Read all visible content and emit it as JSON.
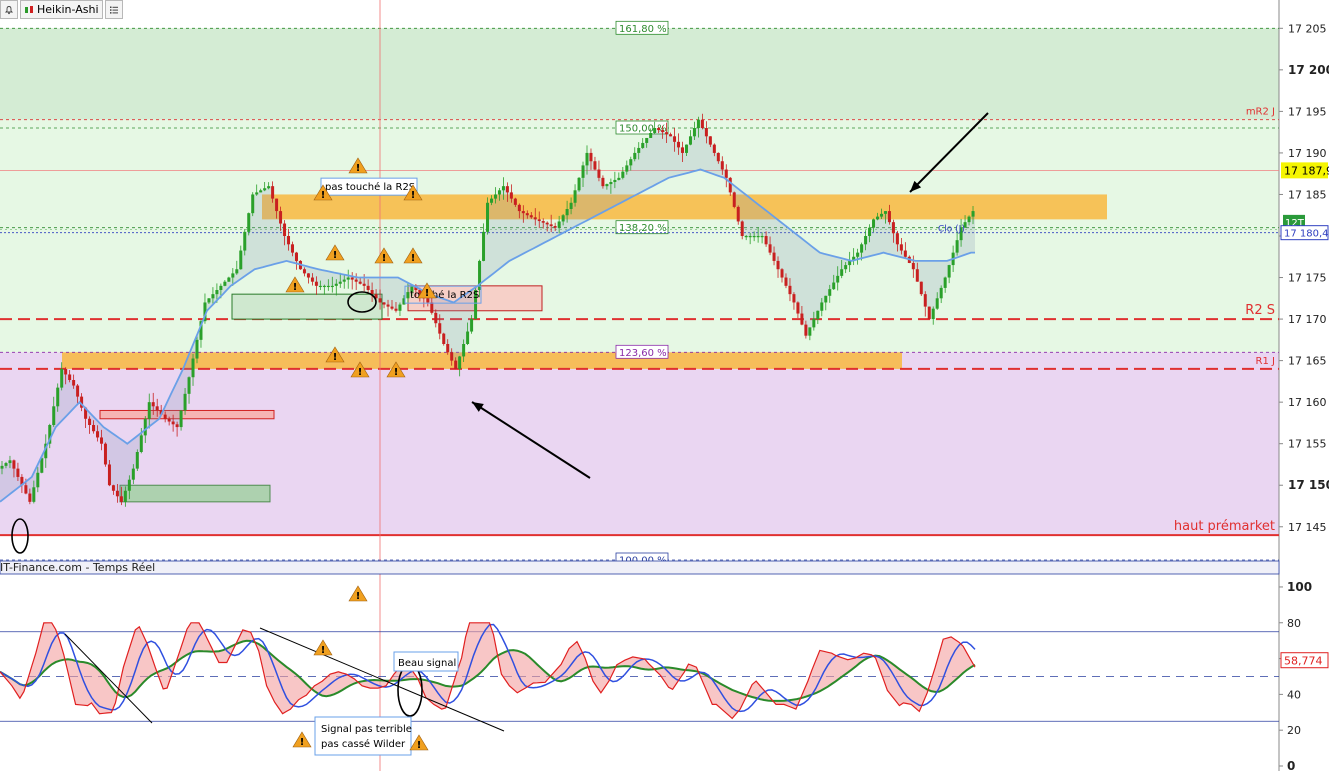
{
  "toolbar": {
    "bell_icon": "bell-icon",
    "chart_type_label": "Heikin-Ashi",
    "chart_type_icon": "candle-icon",
    "list_icon": "list-icon"
  },
  "source_label": "IT-Finance.com - Temps Réel",
  "chart_data": [
    {
      "type": "candlestick",
      "series": [
        {
          "name": "Heikin-Ashi"
        },
        {
          "name": "Clo (J)"
        }
      ],
      "ylim": [
        17141,
        17206
      ],
      "y_ticks": [
        17205,
        17200,
        17195,
        17190,
        17185,
        17180,
        17175,
        17170,
        17165,
        17160,
        17155,
        17150,
        17145
      ],
      "y_tick_labels": [
        "17 205",
        "17 200",
        "17 195",
        "17 190",
        "17 185",
        "17 180",
        "17 175",
        "17 170",
        "17 165",
        "17 160",
        "17 155",
        "17 150",
        "17 145"
      ],
      "bold_ticks": [
        "17 200",
        "17 150"
      ],
      "x_index_range": [
        0,
        245
      ],
      "price_path": [
        [
          0,
          17152
        ],
        [
          3,
          17153
        ],
        [
          8,
          17148
        ],
        [
          12,
          17155
        ],
        [
          16,
          17164
        ],
        [
          19,
          17162
        ],
        [
          22,
          17158
        ],
        [
          26,
          17155
        ],
        [
          28,
          17150
        ],
        [
          31,
          17148
        ],
        [
          34,
          17152
        ],
        [
          38,
          17160
        ],
        [
          42,
          17158
        ],
        [
          45,
          17157
        ],
        [
          48,
          17163
        ],
        [
          52,
          17172
        ],
        [
          56,
          17174
        ],
        [
          60,
          17176
        ],
        [
          64,
          17185
        ],
        [
          68,
          17186
        ],
        [
          72,
          17180
        ],
        [
          76,
          17176
        ],
        [
          80,
          17174
        ],
        [
          84,
          17174
        ],
        [
          88,
          17175
        ],
        [
          92,
          17174
        ],
        [
          96,
          17172
        ],
        [
          100,
          17171
        ],
        [
          104,
          17174
        ],
        [
          108,
          17172
        ],
        [
          112,
          17167
        ],
        [
          115,
          17164
        ],
        [
          119,
          17170
        ],
        [
          123,
          17184
        ],
        [
          127,
          17186
        ],
        [
          131,
          17183
        ],
        [
          135,
          17182
        ],
        [
          140,
          17181
        ],
        [
          144,
          17184
        ],
        [
          148,
          17190
        ],
        [
          152,
          17186
        ],
        [
          156,
          17187
        ],
        [
          160,
          17190
        ],
        [
          165,
          17193
        ],
        [
          169,
          17192
        ],
        [
          172,
          17190
        ],
        [
          176,
          17194
        ],
        [
          180,
          17190
        ],
        [
          183,
          17187
        ],
        [
          187,
          17180
        ],
        [
          192,
          17180
        ],
        [
          196,
          17176
        ],
        [
          200,
          17172
        ],
        [
          203,
          17168
        ],
        [
          207,
          17172
        ],
        [
          212,
          17176
        ],
        [
          216,
          17178
        ],
        [
          220,
          17182
        ],
        [
          223,
          17183
        ],
        [
          226,
          17179
        ],
        [
          230,
          17176
        ],
        [
          234,
          17170
        ],
        [
          238,
          17175
        ],
        [
          242,
          17181
        ],
        [
          245,
          17183
        ]
      ],
      "ma_path": [
        [
          0,
          17148
        ],
        [
          8,
          17151
        ],
        [
          14,
          17157
        ],
        [
          20,
          17160
        ],
        [
          26,
          17157
        ],
        [
          32,
          17155
        ],
        [
          40,
          17158
        ],
        [
          46,
          17164
        ],
        [
          52,
          17171
        ],
        [
          58,
          17174
        ],
        [
          64,
          17176
        ],
        [
          72,
          17177
        ],
        [
          80,
          17176
        ],
        [
          90,
          17175
        ],
        [
          100,
          17175
        ],
        [
          108,
          17173
        ],
        [
          114,
          17172
        ],
        [
          120,
          17174
        ],
        [
          128,
          17177
        ],
        [
          136,
          17179
        ],
        [
          144,
          17181
        ],
        [
          152,
          17183
        ],
        [
          160,
          17185
        ],
        [
          168,
          17187
        ],
        [
          176,
          17188
        ],
        [
          182,
          17187
        ],
        [
          190,
          17184
        ],
        [
          198,
          17181
        ],
        [
          206,
          17178
        ],
        [
          214,
          17177
        ],
        [
          222,
          17178
        ],
        [
          230,
          17177
        ],
        [
          238,
          17177
        ],
        [
          244,
          17178
        ]
      ],
      "fib_levels": [
        {
          "label": "161,80 %",
          "value": 17205,
          "color": "#2e8b2e"
        },
        {
          "label": "150,00 %",
          "value": 17193,
          "color": "#2e8b2e"
        },
        {
          "label": "138,20 %",
          "value": 17181,
          "color": "#2e8b2e"
        },
        {
          "label": "123,60 %",
          "value": 17166,
          "color": "#8a2ca8"
        },
        {
          "label": "100,00 %",
          "value": 17141,
          "color": "#2a3fa0"
        }
      ],
      "pivot_lines": [
        {
          "label": "mR2 J",
          "value": 17194,
          "color": "#e03030"
        },
        {
          "label": "R2 S",
          "value": 17170,
          "color": "#e03030"
        },
        {
          "label": "R1 J",
          "value": 17164,
          "color": "#e03030"
        },
        {
          "label": "haut prémarket",
          "value": 17144,
          "color": "#e03030"
        }
      ],
      "last_price_label": "17 187,9",
      "clo_label": "17 180,4",
      "timeframe_label": "12T",
      "clo_marker_label": "Clo (J)",
      "annotations": [
        {
          "text": "pas touché la R2S"
        },
        {
          "text": "touché la R2S"
        }
      ]
    },
    {
      "type": "line",
      "series": [
        {
          "name": "oscillator",
          "color": "#e02020"
        },
        {
          "name": "signal",
          "color": "#3050e0"
        },
        {
          "name": "smooth",
          "color": "#2a8a2a"
        }
      ],
      "ylim": [
        0,
        105
      ],
      "y_tick_labels": [
        "100",
        "80",
        "60",
        "40",
        "20",
        "0"
      ],
      "y_ticks": [
        100,
        80,
        60,
        40,
        20,
        0
      ],
      "levels": [
        50,
        75,
        25
      ],
      "last_value_label": "58,774",
      "annotations": [
        {
          "text": "Beau signal"
        },
        {
          "text": "Signal pas terrible"
        },
        {
          "text": "pas cassé Wilder"
        }
      ]
    }
  ]
}
